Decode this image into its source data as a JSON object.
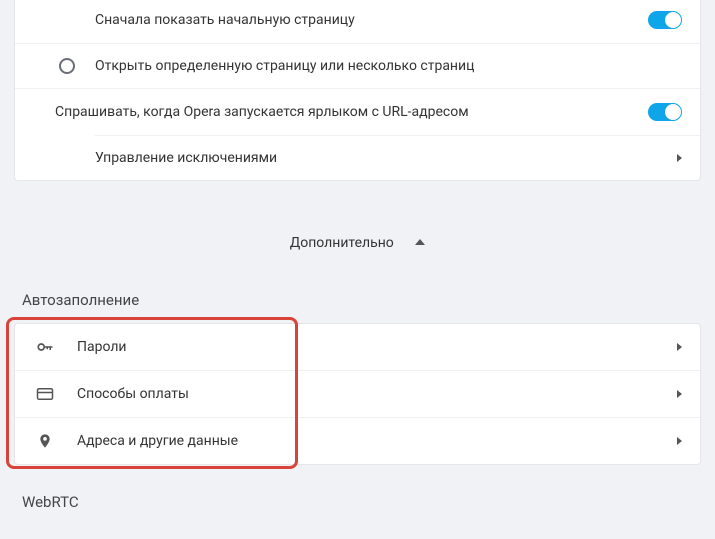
{
  "startup": {
    "show_start_page_label": "Сначала показать начальную страницу",
    "open_specific_label": "Открыть определенную страницу или несколько страниц",
    "ask_url_label": "Спрашивать, когда Opera запускается ярлыком с URL-адресом",
    "manage_exceptions_label": "Управление исключениями"
  },
  "expand_label": "Дополнительно",
  "autofill": {
    "section_title": "Автозаполнение",
    "passwords": "Пароли",
    "payment": "Способы оплаты",
    "addresses": "Адреса и другие данные"
  },
  "webrtc_title": "WebRTC"
}
